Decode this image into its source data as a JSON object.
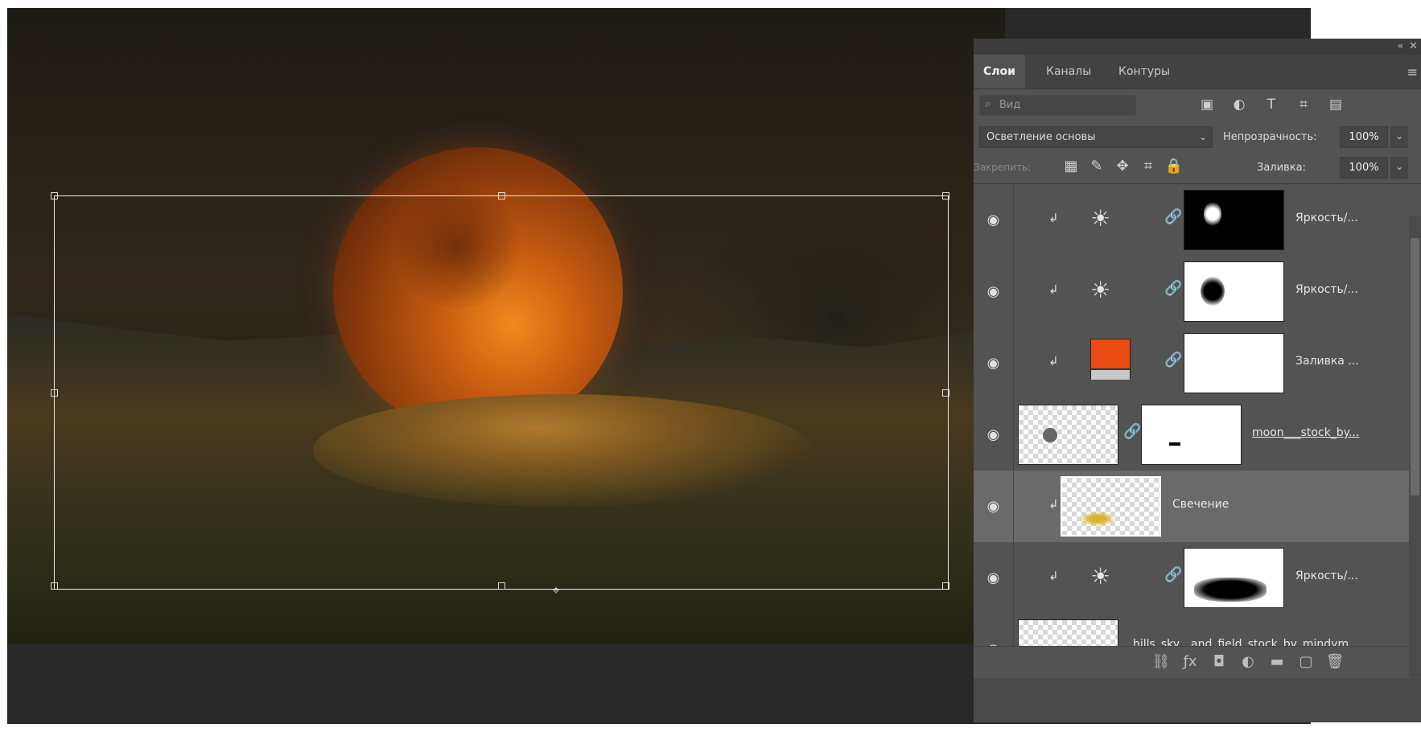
{
  "panel": {
    "tabs": [
      {
        "label": "Слои"
      },
      {
        "label": "Каналы"
      },
      {
        "label": "Контуры"
      }
    ],
    "filter": {
      "placeholder": "Вид"
    },
    "blend_mode": "Осветление основы",
    "opacity_label": "Непрозрачность:",
    "opacity_value": "100%",
    "lock_label": "Закрепить:",
    "fill_label": "Заливка:",
    "fill_value": "100%",
    "layers": [
      {
        "name": "Яркость/..."
      },
      {
        "name": "Яркость/..."
      },
      {
        "name": "Заливка ..."
      },
      {
        "name": "moon___stock_by..."
      },
      {
        "name": "Свечение"
      },
      {
        "name": "Яркость/..."
      },
      {
        "name": "hills_sky__and_field_stock_by_mindym..."
      }
    ],
    "fill_swatch_color": "#ea4b12",
    "selected_layer": "Свечение"
  },
  "icons": {
    "eye": "eye-icon",
    "brightness": "brightness-icon",
    "link": "chain-link-icon"
  }
}
